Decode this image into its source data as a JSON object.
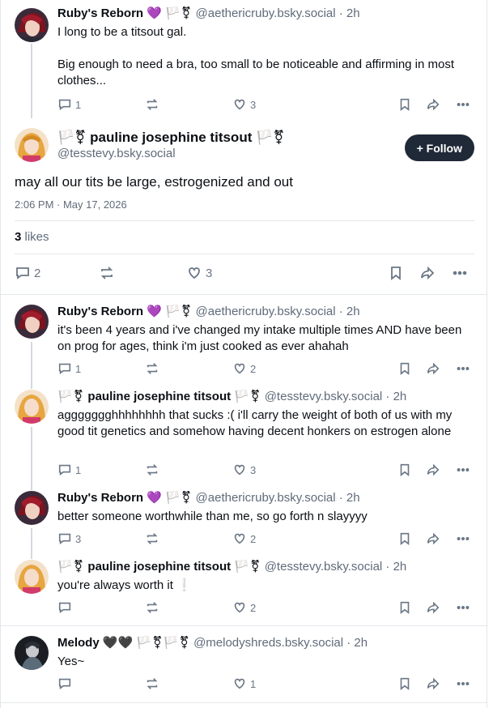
{
  "posts_before": [
    {
      "name": "Ruby's Reborn",
      "flairs": "🏳️⚧",
      "handle": "@aethericruby.bsky.social · 2h",
      "text_lines": [
        "I long to be a titsout gal.",
        "",
        "Big enough to need a bra, too small to be noticeable and affirming in most clothes..."
      ],
      "replies": "1",
      "likes": "3"
    }
  ],
  "main_post": {
    "name": "🏳️⚧ pauline josephine titsout 🏳️⚧",
    "handle": "@tesstevy.bsky.social",
    "follow_label": "+ Follow",
    "text": "may all our tits be large, estrogenized and out",
    "timestamp": "2:06 PM · May 17, 2026",
    "likes_count": "3",
    "likes_label": "likes",
    "replies": "2",
    "like_count": "3"
  },
  "replies": [
    {
      "name": "Ruby's Reborn",
      "flairs": "🏳️⚧",
      "handle": "@aethericruby.bsky.social · 2h",
      "text": "it's been 4 years and i've changed my intake multiple times AND have been on prog for ages, think i'm just cooked as ever ahahah",
      "replies": "1",
      "likes": "2"
    },
    {
      "name": "pauline josephine titsout",
      "flairs": "🏳️⚧",
      "handle": "@tesstevy.bsky.social · 2h",
      "text": "aggggggghhhhhhhh that sucks :( i'll carry the weight of both of us with my good tit genetics and somehow having decent honkers on estrogen alone",
      "replies": "1",
      "likes": "3"
    },
    {
      "name": "Ruby's Reborn",
      "flairs": "🏳️⚧",
      "handle": "@aethericruby.bsky.social · 2h",
      "text": "better someone worthwhile than me, so go forth n slayyyy",
      "replies": "3",
      "likes": "2"
    },
    {
      "name": "pauline josephine titsout",
      "flairs": "🏳️⚧",
      "handle": "@tesstevy.bsky.social · 2h",
      "text": "you're always worth it ❕",
      "replies": "",
      "likes": "2"
    },
    {
      "name": "Melody",
      "flairs": "🏳️⚧🏳️⚧",
      "handle": "@melodyshreds.bsky.social · 2h",
      "text": "Yes~",
      "replies": "",
      "likes": "1"
    }
  ]
}
